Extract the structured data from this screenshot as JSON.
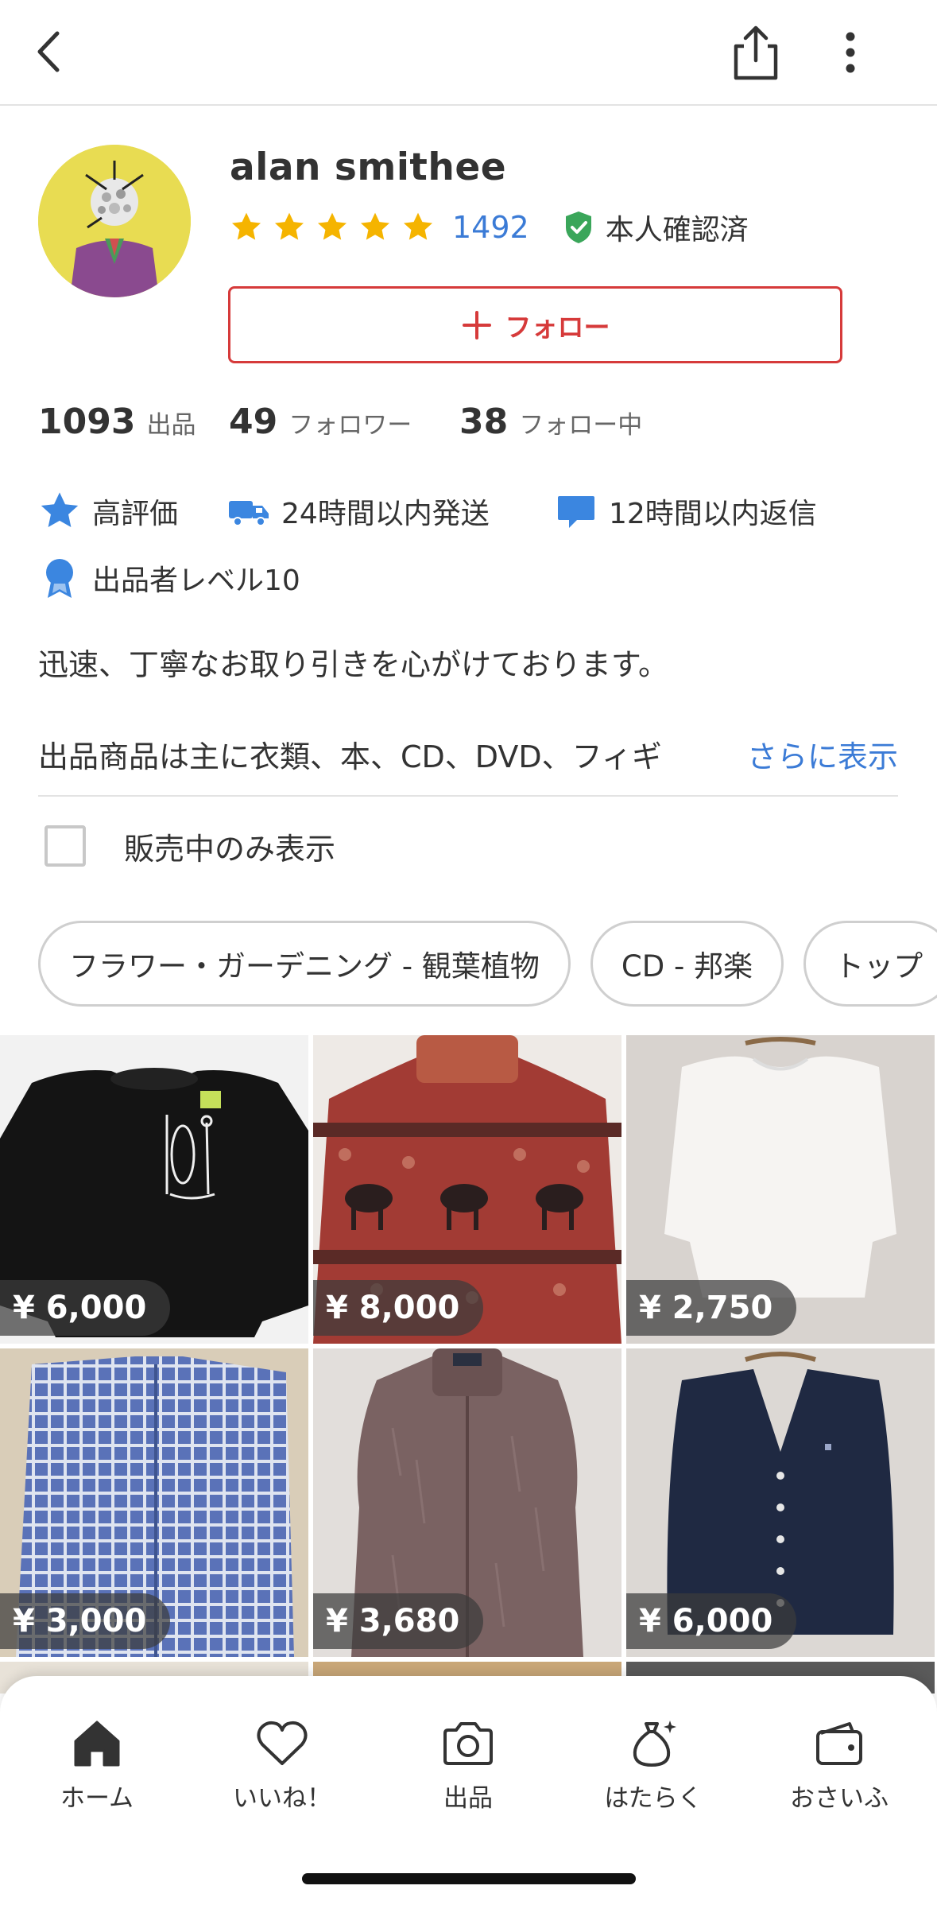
{
  "profile": {
    "username": "alan smithee",
    "rating_stars": 5,
    "review_count": "1492",
    "verified_label": "本人確認済",
    "follow_label": "フォロー"
  },
  "stats": [
    {
      "num": "1093",
      "label": "出品"
    },
    {
      "num": "49",
      "label": "フォロワー"
    },
    {
      "num": "38",
      "label": "フォロー中"
    }
  ],
  "badges": {
    "high_rating": "高評価",
    "shipping": "24時間以内発送",
    "reply": "12時間以内返信",
    "seller_level": "出品者レベル10"
  },
  "description": {
    "line1": "迅速、丁寧なお取り引きを心がけております。",
    "line2": "出品商品は主に衣類、本、CD、DVD、フィギ",
    "more": "さらに表示"
  },
  "filter": {
    "on_sale_only": "販売中のみ表示",
    "checked": false
  },
  "categories": [
    "フラワー・ガーデニング - 観葉植物",
    "CD - 邦楽",
    "トップ"
  ],
  "items": [
    {
      "price": "¥ 6,000"
    },
    {
      "price": "¥ 8,000"
    },
    {
      "price": "¥ 2,750"
    },
    {
      "price": "¥ 3,000"
    },
    {
      "price": "¥ 3,680"
    },
    {
      "price": "¥ 6,000"
    }
  ],
  "bottom_nav": [
    {
      "label": "ホーム",
      "icon": "home-icon"
    },
    {
      "label": "いいね！",
      "icon": "heart-icon"
    },
    {
      "label": "出品",
      "icon": "camera-icon"
    },
    {
      "label": "はたらく",
      "icon": "money-bag-icon"
    },
    {
      "label": "おさいふ",
      "icon": "wallet-icon"
    }
  ],
  "colors": {
    "accent_red": "#d63a3a",
    "link_blue": "#3b7bd6",
    "star_yellow": "#f5b400",
    "verified_green": "#3aa65a"
  }
}
